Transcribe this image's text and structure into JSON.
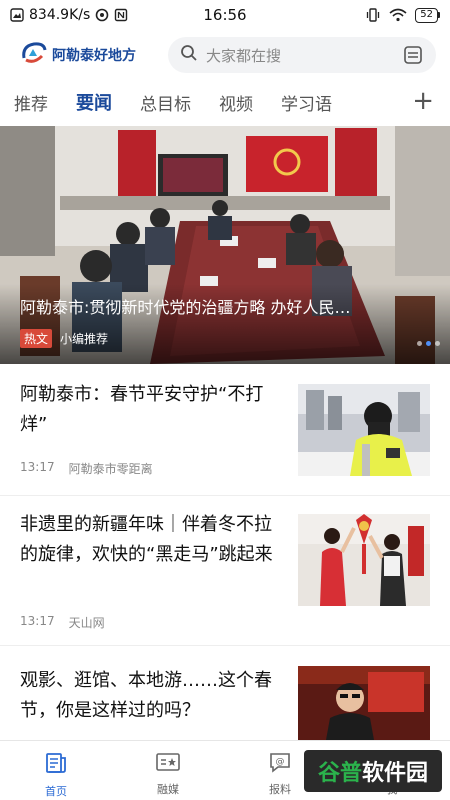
{
  "status_bar": {
    "speed": "834.9K/s",
    "time": "16:56",
    "battery": "52"
  },
  "header": {
    "logo_text": "阿勒泰好地方",
    "search_placeholder": "大家都在搜"
  },
  "tabs": [
    {
      "label": "推荐",
      "active": false
    },
    {
      "label": "要闻",
      "active": true
    },
    {
      "label": "总目标",
      "active": false
    },
    {
      "label": "视频",
      "active": false
    },
    {
      "label": "学习语",
      "active": false
    }
  ],
  "tab_add": "+",
  "banner": {
    "caption": "阿勒泰市:贯彻新时代党的治疆方略 办好人民…",
    "badge": "热文",
    "source": "小编推荐",
    "slide_index": 1
  },
  "articles": [
    {
      "title": "阿勒泰市：春节平安守护“不打烊”",
      "time": "13:17",
      "source": "阿勒泰市零距离"
    },
    {
      "title": "非遗里的新疆年味｜伴着冬不拉的旋律，欢快的“黑走马”跳起来",
      "time": "13:17",
      "source": "天山网"
    },
    {
      "title": "观影、逛馆、本地游……这个春节，你是这样过的吗？",
      "time": "",
      "source": ""
    }
  ],
  "bottom_nav": [
    {
      "label": "首页",
      "icon": "news-icon",
      "active": true
    },
    {
      "label": "融媒",
      "icon": "media-icon",
      "active": false
    },
    {
      "label": "报料",
      "icon": "report-icon",
      "active": false
    },
    {
      "label": "我",
      "icon": "user-icon",
      "active": false
    }
  ],
  "watermark": {
    "text_a": "谷普",
    "text_b": "软件园"
  },
  "colors": {
    "brand": "#1b4a9b",
    "hot": "#d84a3a",
    "nav_active": "#2c6bd4"
  }
}
